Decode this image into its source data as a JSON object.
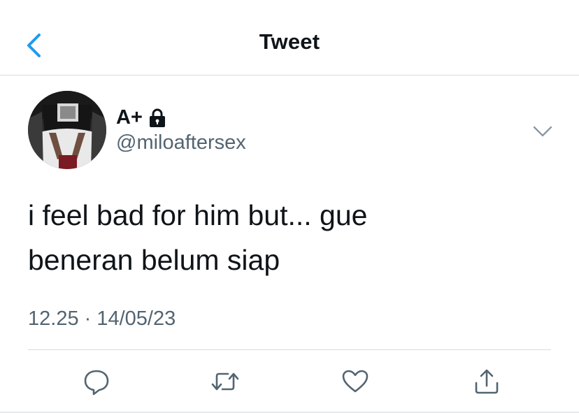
{
  "header": {
    "title": "Tweet",
    "back_icon": "chevron-left-icon",
    "accent_color": "#1d9bf0"
  },
  "tweet": {
    "author": {
      "display_name": "A+",
      "handle": "@miloaftersex",
      "protected_icon": "lock-icon"
    },
    "text_lines": [
      "i feel bad for him but... gue",
      "beneran belum siap"
    ],
    "timestamp": "12.25 · 14/05/23",
    "menu_icon": "chevron-down-icon"
  },
  "actions": [
    {
      "name": "reply",
      "icon": "speech-bubble-icon"
    },
    {
      "name": "retweet",
      "icon": "retweet-icon"
    },
    {
      "name": "like",
      "icon": "heart-icon"
    },
    {
      "name": "share",
      "icon": "share-icon"
    }
  ],
  "colors": {
    "text_primary": "#0f1419",
    "text_secondary": "#536471",
    "icon_gray": "#536471",
    "divider": "#d6d9dc"
  }
}
